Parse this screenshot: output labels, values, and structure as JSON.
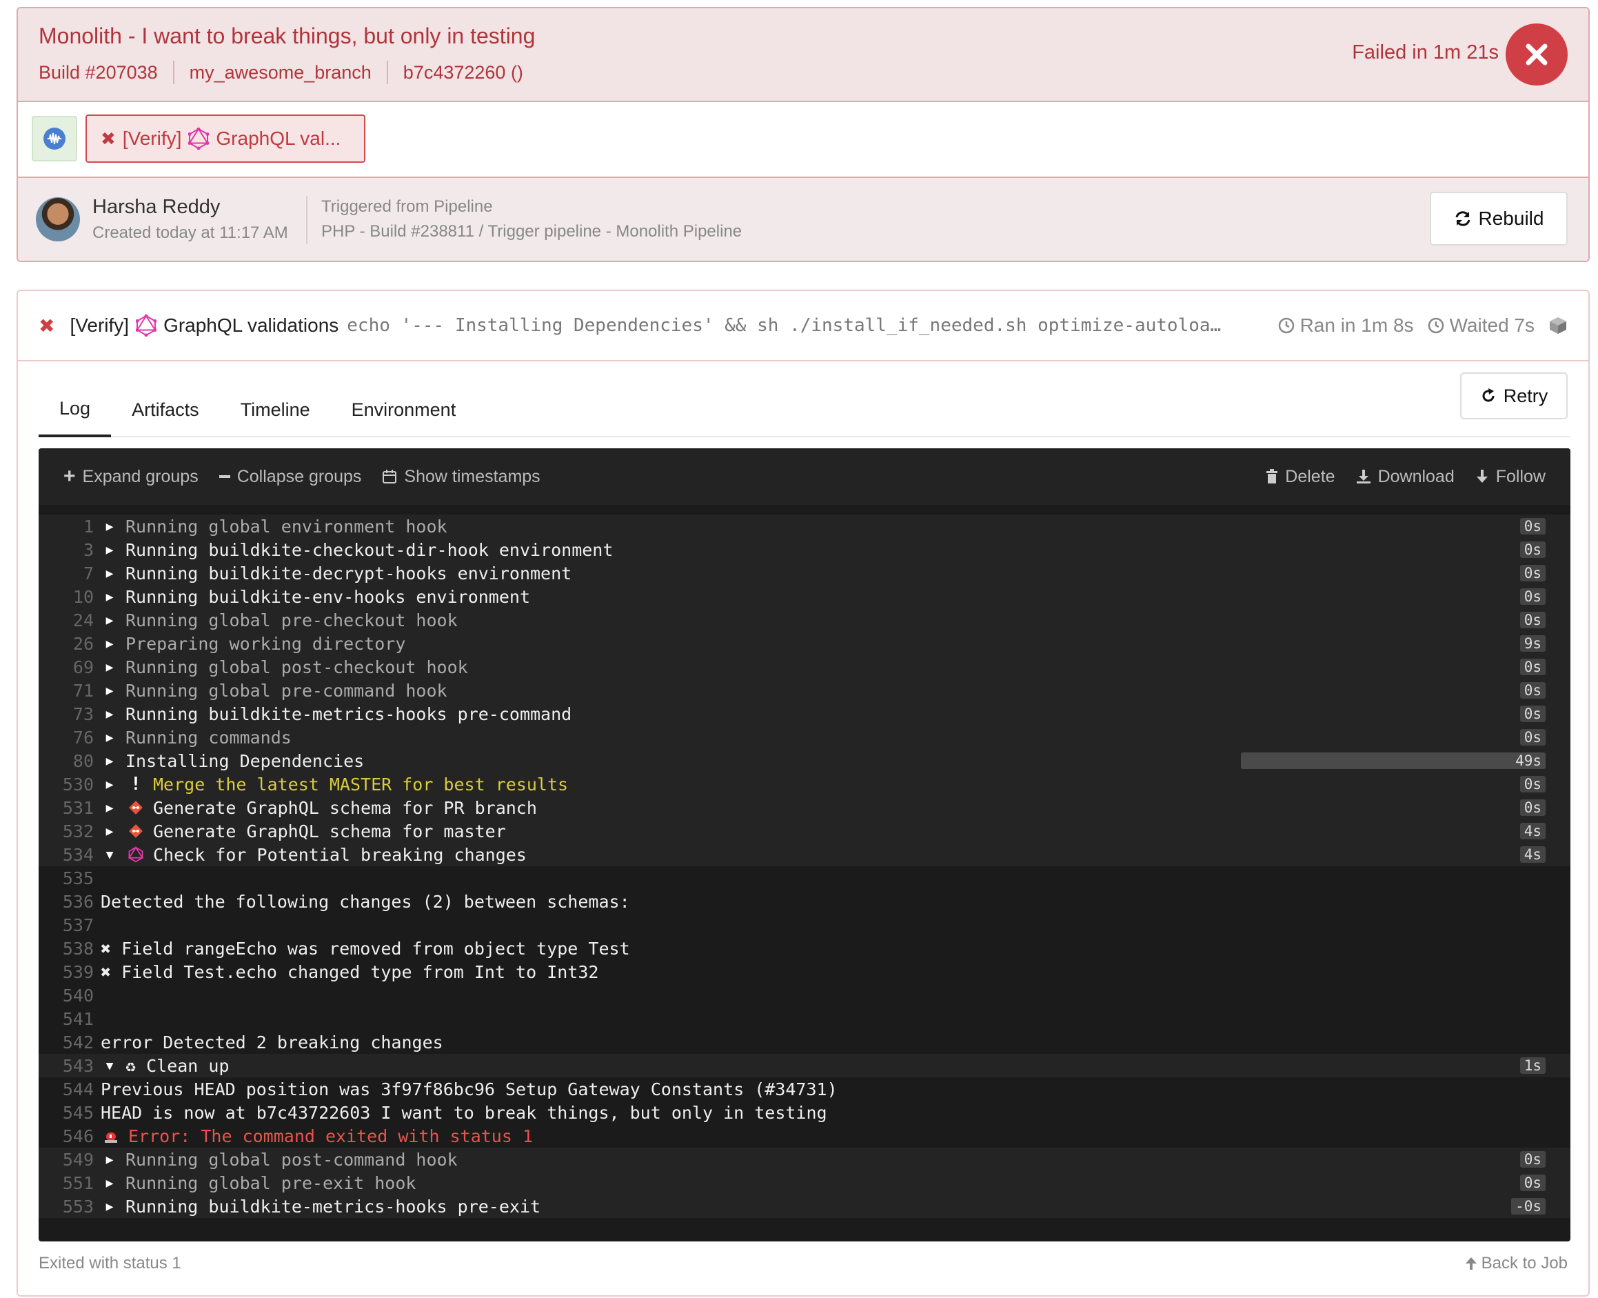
{
  "build": {
    "title": "Monolith - I want to break things, but only in testing",
    "number": "Build #207038",
    "branch": "my_awesome_branch",
    "commit": "b7c4372260 ()",
    "status": "Failed in 1m 21s",
    "colors": {
      "fail": "#d03f45",
      "fail_text": "#b0353b",
      "header_bg": "#f2e3e4"
    }
  },
  "jobs_row": {
    "pipeline_icon": "pipeline-waveform-icon",
    "job_pill_label": "[Verify]",
    "job_pill_name": "GraphQL val..."
  },
  "creator": {
    "name": "Harsha Reddy",
    "created": "Created today at 11:17 AM",
    "trigger_label": "Triggered from Pipeline",
    "trigger_text": "PHP - Build #238811 / Trigger pipeline - Monolith Pipeline",
    "rebuild_label": "Rebuild"
  },
  "job": {
    "prefix": "[Verify]",
    "name": "GraphQL validations",
    "command": "echo '--- Installing Dependencies' && sh ./install_if_needed.sh optimize-autoloader…",
    "ran": "Ran in 1m 8s",
    "waited": "Waited 7s"
  },
  "tabs": [
    "Log",
    "Artifacts",
    "Timeline",
    "Environment"
  ],
  "retry_label": "Retry",
  "toolbar": {
    "expand": "Expand groups",
    "collapse": "Collapse groups",
    "timestamps": "Show timestamps",
    "delete": "Delete",
    "download": "Download",
    "follow": "Follow"
  },
  "log": [
    {
      "n": "1",
      "kind": "group",
      "tri": "right",
      "text": "Running global environment hook",
      "style": "dim",
      "dur": "0s"
    },
    {
      "n": "3",
      "kind": "group",
      "tri": "right",
      "text": "Running buildkite-checkout-dir-hook environment",
      "style": "",
      "dur": "0s"
    },
    {
      "n": "7",
      "kind": "group",
      "tri": "right",
      "text": "Running buildkite-decrypt-hooks environment",
      "style": "",
      "dur": "0s"
    },
    {
      "n": "10",
      "kind": "group",
      "tri": "right",
      "text": "Running buildkite-env-hooks environment",
      "style": "",
      "dur": "0s"
    },
    {
      "n": "24",
      "kind": "group",
      "tri": "right",
      "text": "Running global pre-checkout hook",
      "style": "dim",
      "dur": "0s"
    },
    {
      "n": "26",
      "kind": "group",
      "tri": "right",
      "text": "Preparing working directory",
      "style": "dim",
      "dur": "9s"
    },
    {
      "n": "69",
      "kind": "group",
      "tri": "right",
      "text": "Running global post-checkout hook",
      "style": "dim",
      "dur": "0s"
    },
    {
      "n": "71",
      "kind": "group",
      "tri": "right",
      "text": "Running global pre-command hook",
      "style": "dim",
      "dur": "0s"
    },
    {
      "n": "73",
      "kind": "group",
      "tri": "right",
      "text": "Running buildkite-metrics-hooks pre-command",
      "style": "",
      "dur": "0s"
    },
    {
      "n": "76",
      "kind": "group",
      "tri": "right",
      "text": "Running commands",
      "style": "dim",
      "dur": "0s"
    },
    {
      "n": "80",
      "kind": "group",
      "tri": "right",
      "text": "Installing Dependencies",
      "style": "",
      "dur": "49s",
      "progress": 1
    },
    {
      "n": "530",
      "kind": "group",
      "tri": "right",
      "icon": "exclamation",
      "text": "Merge the latest MASTER for best results",
      "style": "yellow",
      "dur": "0s"
    },
    {
      "n": "531",
      "kind": "group",
      "tri": "right",
      "icon": "git",
      "text": "Generate GraphQL schema for PR branch",
      "style": "",
      "dur": "0s"
    },
    {
      "n": "532",
      "kind": "group",
      "tri": "right",
      "icon": "git",
      "text": "Generate GraphQL schema for master",
      "style": "",
      "dur": "4s"
    },
    {
      "n": "534",
      "kind": "group",
      "tri": "down",
      "icon": "graphql",
      "text": "Check for Potential breaking changes",
      "style": "",
      "dur": "4s"
    },
    {
      "n": "535",
      "kind": "plain",
      "tri": "",
      "text": "",
      "style": ""
    },
    {
      "n": "536",
      "kind": "plain",
      "tri": "",
      "text": "Detected the following changes (2) between schemas:",
      "style": ""
    },
    {
      "n": "537",
      "kind": "plain",
      "tri": "",
      "text": "",
      "style": ""
    },
    {
      "n": "538",
      "kind": "plain",
      "tri": "",
      "text": "✖ Field rangeEcho was removed from object type Test",
      "style": ""
    },
    {
      "n": "539",
      "kind": "plain",
      "tri": "",
      "text": "✖ Field Test.echo changed type from Int to Int32",
      "style": ""
    },
    {
      "n": "540",
      "kind": "plain",
      "tri": "",
      "text": "",
      "style": ""
    },
    {
      "n": "541",
      "kind": "plain",
      "tri": "",
      "text": "",
      "style": ""
    },
    {
      "n": "542",
      "kind": "plain",
      "tri": "",
      "text": "error Detected 2 breaking changes",
      "style": ""
    },
    {
      "n": "543",
      "kind": "group",
      "tri": "down",
      "text": "♻ Clean up",
      "style": "",
      "dur": "1s"
    },
    {
      "n": "544",
      "kind": "plain",
      "tri": "",
      "text": "Previous HEAD position was 3f97f86bc96 Setup Gateway Constants (#34731)",
      "style": ""
    },
    {
      "n": "545",
      "kind": "plain",
      "tri": "",
      "text": "HEAD is now at b7c43722603 I want to break things, but only in testing",
      "style": ""
    },
    {
      "n": "546",
      "kind": "plain",
      "tri": "",
      "icon": "siren",
      "text": "Error: The command exited with status 1",
      "style": "red"
    },
    {
      "n": "549",
      "kind": "group",
      "tri": "right",
      "text": "Running global post-command hook",
      "style": "dim",
      "dur": "0s"
    },
    {
      "n": "551",
      "kind": "group",
      "tri": "right",
      "text": "Running global pre-exit hook",
      "style": "dim",
      "dur": "0s"
    },
    {
      "n": "553",
      "kind": "group",
      "tri": "right",
      "text": "Running buildkite-metrics-hooks pre-exit",
      "style": "",
      "dur": "-0s"
    }
  ],
  "footer": {
    "exit": "Exited with status 1",
    "back": "Back to Job"
  }
}
